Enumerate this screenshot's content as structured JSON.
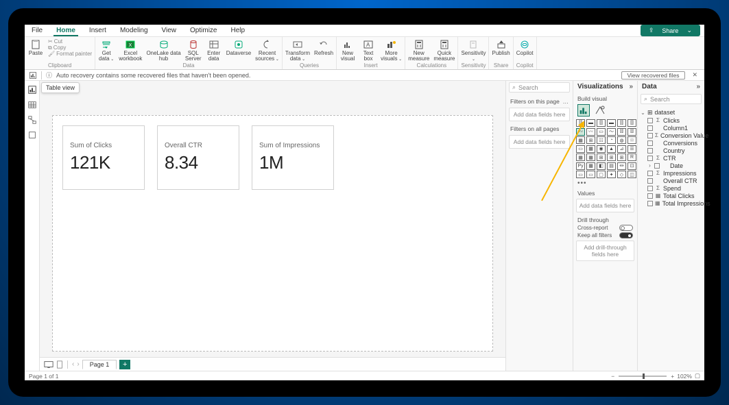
{
  "menu": {
    "items": [
      "File",
      "Home",
      "Insert",
      "Modeling",
      "View",
      "Optimize",
      "Help"
    ],
    "active": "Home",
    "share": "Share"
  },
  "ribbon": {
    "clipboard": {
      "paste": "Paste",
      "cut": "Cut",
      "copy": "Copy",
      "fmt": "Format painter",
      "label": "Clipboard"
    },
    "data_group": {
      "items": [
        "Get data",
        "Excel workbook",
        "OneLake data hub",
        "SQL Server",
        "Enter data",
        "Dataverse",
        "Recent sources"
      ],
      "label": "Data"
    },
    "queries": {
      "items": [
        "Transform data",
        "Refresh"
      ],
      "label": "Queries"
    },
    "insert": {
      "items": [
        "New visual",
        "Text box",
        "More visuals"
      ],
      "label": "Insert"
    },
    "calc": {
      "items": [
        "New measure",
        "Quick measure"
      ],
      "label": "Calculations"
    },
    "sensitivity": {
      "items": [
        "Sensitivity"
      ],
      "label": "Sensitivity"
    },
    "share": {
      "items": [
        "Publish"
      ],
      "label": "Share"
    },
    "copilot": {
      "items": [
        "Copilot"
      ],
      "label": "Copilot"
    }
  },
  "recovery": {
    "msg": "Auto recovery contains some recovered files that haven't been opened.",
    "btn": "View recovered files"
  },
  "tooltip": "Table view",
  "cards": [
    {
      "title": "Sum of Clicks",
      "value": "121K"
    },
    {
      "title": "Overall CTR",
      "value": "8.34"
    },
    {
      "title": "Sum of Impressions",
      "value": "1M"
    }
  ],
  "filters": {
    "search": "Search",
    "on_page": "Filters on this page",
    "on_all": "Filters on all pages",
    "add": "Add data fields here"
  },
  "viz": {
    "title": "Visualizations",
    "build": "Build visual",
    "values": "Values",
    "add": "Add data fields here",
    "drill": "Drill through",
    "cross": "Cross-report",
    "keep": "Keep all filters",
    "drill_add": "Add drill-through fields here"
  },
  "data": {
    "title": "Data",
    "search": "Search",
    "table": "dataset",
    "fields": [
      {
        "name": "Clicks",
        "sig": "Σ"
      },
      {
        "name": "Column1",
        "sig": ""
      },
      {
        "name": "Conversion Value",
        "sig": "Σ"
      },
      {
        "name": "Conversions",
        "sig": ""
      },
      {
        "name": "Country",
        "sig": ""
      },
      {
        "name": "CTR",
        "sig": "Σ"
      },
      {
        "name": "Date",
        "sig": "",
        "chev": true
      },
      {
        "name": "Impressions",
        "sig": "Σ"
      },
      {
        "name": "Overall CTR",
        "sig": ""
      },
      {
        "name": "Spend",
        "sig": "Σ"
      },
      {
        "name": "Total Clicks",
        "sig": "▦"
      },
      {
        "name": "Total Impressions",
        "sig": "▦"
      }
    ]
  },
  "pager": {
    "page": "Page 1"
  },
  "status": {
    "page": "Page 1 of 1",
    "zoom": "102%"
  }
}
